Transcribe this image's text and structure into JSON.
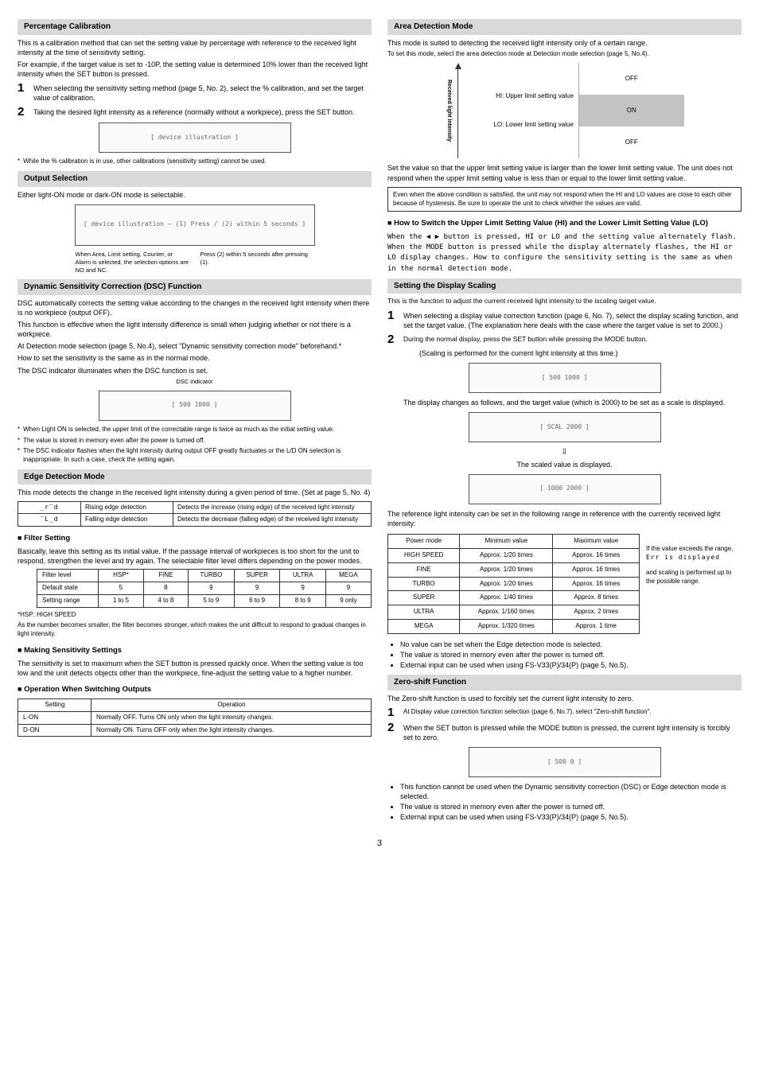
{
  "left": {
    "percentage_calibration": {
      "heading": "Percentage Calibration",
      "intro1": "This is a calibration method that can set the setting value by percentage with reference to the received light intensity at the time of sensitivity setting.",
      "intro2": "For example, if the target value is set to -10P, the setting value is determined 10% lower than the received light intensity when the SET button is pressed.",
      "step1": "When selecting the sensitivity setting method (page 5, No. 2), select the % calibration, and set the target value of calibration.",
      "step2": "Taking the desired light intensity as a reference (normally without a workpiece), press the SET button.",
      "diag_placeholder": "[ device illustration ]",
      "footnote": "While the % calibration is in use, other calibrations (sensitivity setting) cannot be used."
    },
    "output_selection": {
      "heading": "Output Selection",
      "intro": "Either light-ON mode or dark-ON mode is selectable.",
      "diag_placeholder": "[ device illustration — (1) Press / (2) within 5 seconds ]",
      "cap_left": "When Area, Limit setting, Counter, or Alarm is selected, the selection options are NO and NC.",
      "cap_right": "Press (2) within 5 seconds after pressing (1)."
    },
    "dsc": {
      "heading": "Dynamic Sensitivity Correction (DSC) Function",
      "p1": "DSC automatically corrects the setting value according to the changes in the received light intensity when there is no workpiece (output OFF).",
      "p2": "This function is effective when the light intensity difference is small when judging whether or not there is a workpiece.",
      "p3": "At Detection mode selection (page 5, No.4), select \"Dynamic sensitivity correction mode\" beforehand.*",
      "p4": "How to set the sensitivity is the same as in the normal mode.",
      "p5": "The DSC indicator illuminates when the DSC function is set.",
      "diag_label": "DSC indicator",
      "diag_placeholder": "[ 500  1000 ]",
      "fn1": "When Light ON is selected, the upper limit of the correctable range is twice as much as the initial setting value.",
      "fn2": "The value is stored in memory even after the power is turned off.",
      "fn3": "The DSC indicator flashes when the light intensity during output OFF greatly fluctuates or the L/D ON selection is inappropriate. In such a case, check the setting again."
    },
    "edge": {
      "heading": "Edge Detection Mode",
      "intro": "This mode detects the change in the received light intensity during a given period of time. (Set at page 5, No. 4)",
      "r1c1": "_r‾d",
      "r1c2": "Rising edge detection",
      "r1c3": "Detects the increase (rising edge) of the received light intensity",
      "r2c1": "‾L_d",
      "r2c2": "Falling edge detection",
      "r2c3": "Detects the decrease (falling edge) of the received light intensity",
      "filter_heading": "Filter Setting",
      "filter_intro": "Basically, leave this setting as its initial value. If the passage interval of workpieces is too short for the unit to respond, strengthen the level and try again. The selectable filter level differs depending on the power modes.",
      "f_h1": "Filter level",
      "f_h2": "HSP*",
      "f_h3": "FINE",
      "f_h4": "TURBO",
      "f_h5": "SUPER",
      "f_h6": "ULTRA",
      "f_h7": "MEGA",
      "f_r1c1": "Default state",
      "f_r1c2": "5",
      "f_r1c3": "8",
      "f_r1c4": "9",
      "f_r1c5": "9",
      "f_r1c6": "9",
      "f_r1c7": "9",
      "f_r2c1": "Setting range",
      "f_r2c2": "1 to 5",
      "f_r2c3": "4 to 8",
      "f_r2c4": "5 to 9",
      "f_r2c5": "6 to 9",
      "f_r2c6": "8 to 9",
      "f_r2c7": "9 only",
      "hsp_note": "*HSP: HIGH SPEED",
      "hsp_note2": "As the number becomes smaller, the filter becomes stronger, which makes the unit difficult to respond to gradual changes in light intensity.",
      "sens_heading": "Making Sensitivity Settings",
      "sens_p": "The sensitivity is set to maximum when the SET button is pressed quickly once. When the setting value is too low and the unit detects objects other than the workpiece, fine-adjust the setting value to a higher number.",
      "oper_heading": "Operation When Switching Outputs",
      "o_h1": "Setting",
      "o_h2": "Operation",
      "o_r1c1": "L-ON",
      "o_r1c2": "Normally OFF. Turns ON only when the light intensity changes.",
      "o_r2c1": "D-ON",
      "o_r2c2": "Normally ON. Turns OFF only when the light intensity changes."
    }
  },
  "right": {
    "area": {
      "heading": "Area Detection Mode",
      "intro1": "This mode is suited to detecting the received light intensity only of a certain range.",
      "intro2": "To set this mode, select the area detection mode at Detection mode selection (page 5, No.4).",
      "axis": "Received light intensity",
      "hi": "HI: Upper limit setting value",
      "lo": "LO: Lower limit setting value",
      "off": "OFF",
      "on": "ON",
      "p_after": "Set the value so that the upper limit setting value is larger than the lower limit setting value. The unit does not respond when the upper limit setting value is less than or equal to the lower limit setting value.",
      "box": "Even when the above condition is satisfied, the unit may not respond when the HI and LO values are close to each other because of hysteresis. Be sure to operate the unit to check whether the values are valid.",
      "switch_heading": "How to Switch the Upper Limit Setting Value (HI) and the Lower Limit Setting Value (LO)",
      "switch_p": "When the  ◀ ▶  button is pressed, HI or LO and the setting value alternately flash. When the MODE button is pressed while the display alternately flashes, the HI or LO display changes. How to configure the sensitivity setting is the same as when in the normal detection mode."
    },
    "scaling": {
      "heading": "Setting the Display Scaling",
      "intro": "This is the function to adjust the current received light intensity to the iscaling target value.",
      "step1": "When selecting a display value correction function (page 6, No. 7), select the display scaling function, and set the target value. (The explanation here deals with the case where the target value is set to 2000.)",
      "step2": "During the normal display, press the SET button while pressing the MODE button.",
      "scaling_note": "(Scaling is performed for the current light intensity at this time.)",
      "diag1": "[ 500  1000 ]",
      "between": "The display changes as follows, and the target value (which is 2000) to be set as a scale is displayed.",
      "diag2": "[ SCAL 2000 ]",
      "scaled_label": "The scaled value is displayed.",
      "diag3": "[ 1000 2000 ]",
      "ref_p": "The reference light intensity can be set in the following range in reference with the currently received light intensity:",
      "p_h1": "Power mode",
      "p_h2": "Minimum value",
      "p_h3": "Maximum value",
      "pm1": "HIGH SPEED",
      "pm1a": "Approx. 1/20 times",
      "pm1b": "Approx. 16 times",
      "pm2": "FINE",
      "pm2a": "Approx. 1/20 times",
      "pm2b": "Approx. 16 times",
      "pm3": "TURBO",
      "pm3a": "Approx. 1/20 times",
      "pm3b": "Approx. 16 times",
      "pm4": "SUPER",
      "pm4a": "Approx. 1/40 times",
      "pm4b": "Approx. 8 times",
      "pm5": "ULTRA",
      "pm5a": "Approx. 1/160 times",
      "pm5b": "Approx. 2 times",
      "pm6": "MEGA",
      "pm6a": "Approx. 1/320 times",
      "pm6b": "Approx. 1 time",
      "side1": "If the value exceeds the range,",
      "side2": "Err is displayed",
      "side3": "and scaling is performed up to the possible range.",
      "b1": "No value can be set when the Edge detection mode is selected.",
      "b2": "The value is stored in memory even after the power is turned off.",
      "b3": "External input can be used when using FS-V33(P)/34(P) (page 5, No.5)."
    },
    "zero": {
      "heading": "Zero-shift Function",
      "intro": "The Zero-shift function is used to forcibly set the current light intensity to zero.",
      "step1": "At Display value correction function selection (page 6, No.7), select \"Zero-shift function\".",
      "step2": "When the SET button is pressed while the MODE button is pressed, the current light intensity is forcibly set to zero.",
      "diag": "[ 500     0 ]",
      "b1": "This function cannot be used when the Dynamic sensitivity correction (DSC) or Edge detection mode is selected.",
      "b2": "The value is stored in memory even after the power is turned off.",
      "b3": "External input can be used when using FS-V33(P)/34(P) (page 5, No.5)."
    }
  },
  "page_number": "3"
}
